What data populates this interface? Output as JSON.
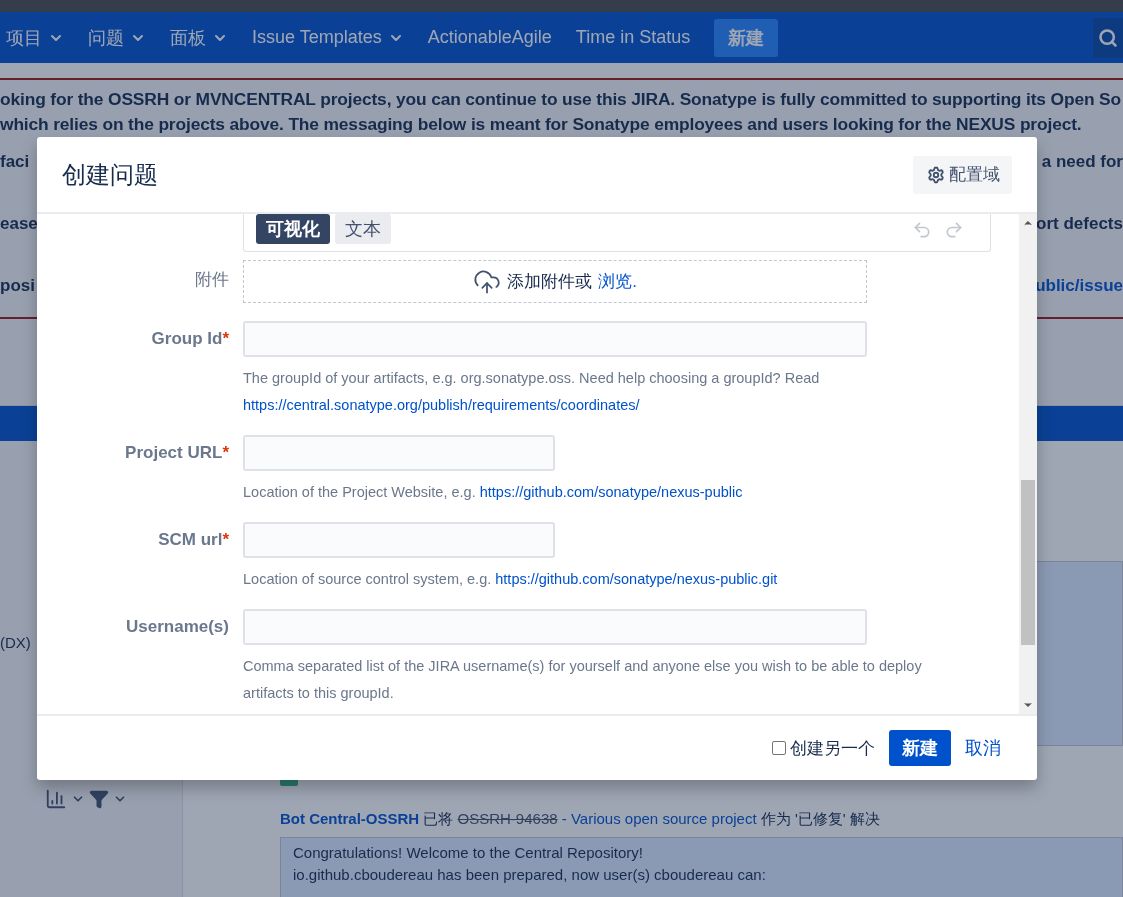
{
  "nav": {
    "items": [
      {
        "label": "项目",
        "dropdown": true
      },
      {
        "label": "问题",
        "dropdown": true
      },
      {
        "label": "面板",
        "dropdown": true
      },
      {
        "label": "Issue Templates",
        "dropdown": true
      },
      {
        "label": "ActionableAgile",
        "dropdown": false
      },
      {
        "label": "Time in Status",
        "dropdown": false
      }
    ],
    "create_button": "新建"
  },
  "banner": {
    "lines": [
      "oking for the OSSRH or MVNCENTRAL projects, you can continue to use this JIRA. Sonatype is fully committed to supporting its Open So",
      "which relies on the projects above. The messaging below is meant for Sonatype employees and users looking for the NEXUS project."
    ],
    "fragment_rows": [
      {
        "left": "faci",
        "right": "a need for",
        "right_link": false
      },
      {
        "left": "ease",
        "right": "ort defects",
        "right_link": false
      },
      {
        "left": "posi",
        "right": "ublic/issue",
        "right_link": true
      }
    ]
  },
  "sidebar": {
    "text": "(DX)"
  },
  "activity": {
    "actor": "Bot Central-OSSRH",
    "verb": "已将",
    "issue_key": "OSSRH-94638",
    "resolved": true,
    "issue_title": "- Various open source project",
    "result": "作为 '已修复' 解决",
    "comment_lines": [
      "Congratulations! Welcome to the Central Repository!",
      "io.github.cboudereau has been prepared, now user(s) cboudereau can:"
    ]
  },
  "dialog": {
    "title": "创建问题",
    "config_button": "配置域",
    "editor_tabs": [
      {
        "label": "可视化",
        "selected": true
      },
      {
        "label": "文本",
        "selected": false
      }
    ],
    "attachment": {
      "label": "附件",
      "text": "添加附件或",
      "link": "浏览."
    },
    "fields": [
      {
        "label": "Group Id",
        "marker": "*",
        "kind": "long",
        "help": "The groupId of your artifacts, e.g. org.sonatype.oss. Need help choosing a groupId? Read",
        "help_link": "https://central.sonatype.org/publish/requirements/coordinates/"
      },
      {
        "label": "Project URL",
        "marker": "*",
        "kind": "short",
        "help": "Location of the Project Website, e.g.",
        "help_link": "https://github.com/sonatype/nexus-public"
      },
      {
        "label": "SCM url",
        "marker": "*",
        "kind": "short",
        "help": "Location of source control system, e.g.",
        "help_link": "https://github.com/sonatype/nexus-public.git"
      },
      {
        "label": "Username(s)",
        "kind": "long",
        "help": "Comma separated list of the JIRA username(s) for yourself and anyone else you wish to be able to deploy artifacts to this groupId."
      }
    ],
    "footer": {
      "create_another": {
        "label": "创建另一个",
        "checked": false
      },
      "submit": "新建",
      "cancel": "取消"
    }
  }
}
